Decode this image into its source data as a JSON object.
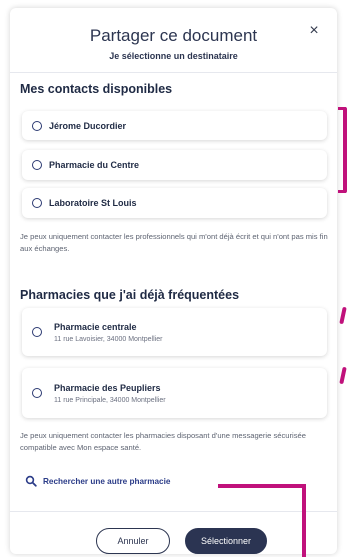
{
  "dialog": {
    "title": "Partager ce document",
    "subtitle": "Je sélectionne un destinataire",
    "close_label": "×"
  },
  "contacts": {
    "heading": "Mes contacts disponibles",
    "items": [
      {
        "name": "Jérome Ducordier",
        "selected": false
      },
      {
        "name": "Pharmacie du Centre",
        "selected": false
      },
      {
        "name": "Laboratoire St Louis",
        "selected": false
      }
    ],
    "note": "Je peux uniquement contacter les professionnels qui m'ont déjà écrit et qui n'ont pas mis fin aux échanges."
  },
  "pharmacies": {
    "heading": "Pharmacies que j'ai déjà fréquentées",
    "items": [
      {
        "name": "Pharmacie centrale",
        "address": "11 rue Lavoisier, 34000 Montpellier",
        "selected": false
      },
      {
        "name": "Pharmacie des Peupliers",
        "address": "11 rue Principale, 34000 Montpellier",
        "selected": false
      }
    ],
    "note": "Je peux uniquement contacter les pharmacies disposant d'une messagerie sécurisée compatible avec Mon espace santé."
  },
  "search": {
    "label": "Rechercher une autre pharmacie",
    "icon": "search-icon"
  },
  "footer": {
    "cancel_label": "Annuler",
    "select_label": "Sélectionner"
  },
  "colors": {
    "primary": "#2b3452",
    "link": "#2b3c88",
    "annotation": "#c0117b"
  }
}
